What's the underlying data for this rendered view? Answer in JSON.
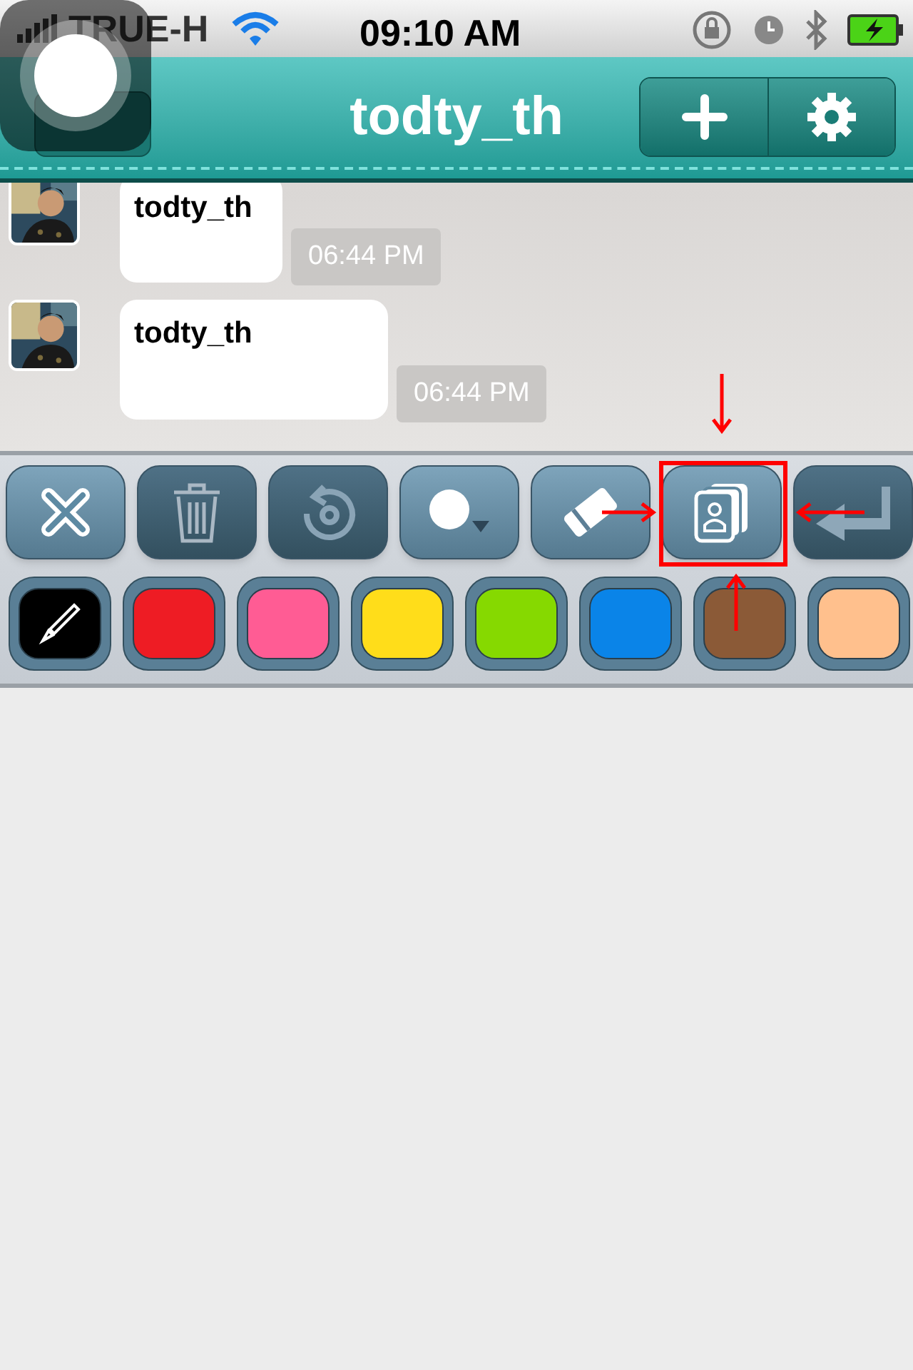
{
  "status_bar": {
    "carrier": "TRUE-H",
    "time": "09:10 AM"
  },
  "nav": {
    "title": "todty_th"
  },
  "messages": [
    {
      "sender": "todty_th",
      "time": "06:44 PM"
    },
    {
      "sender": "todty_th",
      "time": "06:44 PM"
    }
  ],
  "tools": [
    {
      "kind": "close",
      "dark": false,
      "highlighted": false
    },
    {
      "kind": "trash",
      "dark": true,
      "highlighted": false
    },
    {
      "kind": "undo",
      "dark": true,
      "highlighted": false
    },
    {
      "kind": "brush-size",
      "dark": false,
      "highlighted": false
    },
    {
      "kind": "eraser",
      "dark": false,
      "highlighted": false
    },
    {
      "kind": "cards",
      "dark": false,
      "highlighted": true
    },
    {
      "kind": "enter",
      "dark": true,
      "highlighted": false
    }
  ],
  "colors": [
    {
      "color": "#000000",
      "selected": true
    },
    {
      "color": "#ee1c24",
      "selected": false
    },
    {
      "color": "#ff5c94",
      "selected": false
    },
    {
      "color": "#ffdd1a",
      "selected": false
    },
    {
      "color": "#86d900",
      "selected": false
    },
    {
      "color": "#0a84e8",
      "selected": false
    },
    {
      "color": "#8b5a37",
      "selected": false
    },
    {
      "color": "#ffc08d",
      "selected": false
    }
  ],
  "annotations": [
    {
      "kind": "box"
    },
    {
      "kind": "arrow-down"
    },
    {
      "kind": "arrow-right"
    },
    {
      "kind": "arrow-left"
    },
    {
      "kind": "arrow-up"
    }
  ]
}
